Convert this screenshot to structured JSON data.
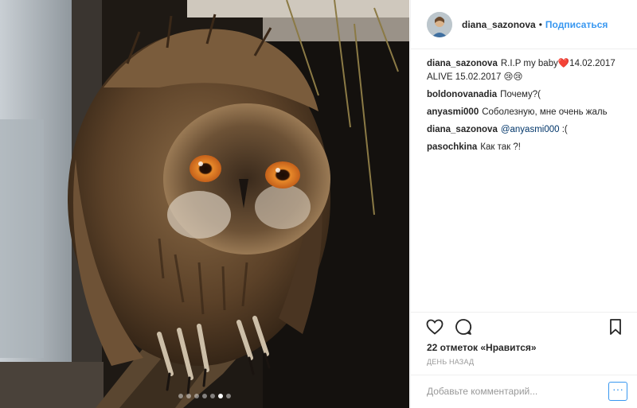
{
  "post": {
    "username": "diana_sazonova",
    "separator": "•",
    "follow_label": "Подписаться",
    "caption": {
      "author": "diana_sazonova",
      "text": "R.I.P my baby❤️14.02.2017 ALIVE 15.02.2017 😢😢"
    },
    "comments": [
      {
        "author": "boldonovanadia",
        "text": "Почему?("
      },
      {
        "author": "anyasmi000",
        "text": "Соболезную, мне очень жаль"
      },
      {
        "author": "diana_sazonova",
        "mention": "@anyasmi000",
        "text": " :("
      },
      {
        "author": "pasochkina",
        "text": "Как так ?!"
      }
    ],
    "likes_text": "22 отметок «Нравится»",
    "time_text": "ДЕНЬ НАЗАД",
    "add_comment_placeholder": "Добавьте комментарий...",
    "more_label": "···",
    "carousel": {
      "count": 7,
      "active_index": 5
    }
  },
  "colors": {
    "link": "#3897f0",
    "border": "#efefef",
    "text": "#262626",
    "muted": "#999999"
  },
  "icons": {
    "like": "heart-icon",
    "comment": "speech-bubble-icon",
    "save": "bookmark-icon"
  }
}
